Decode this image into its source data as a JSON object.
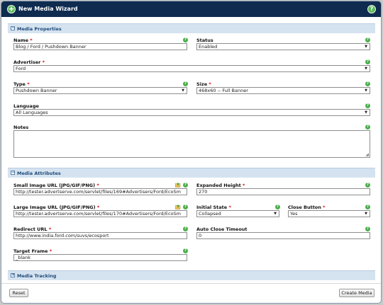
{
  "header": {
    "title": "New Media Wizard",
    "help_glyph": "?",
    "plus_glyph": "+"
  },
  "sections": {
    "properties": "Media Properties",
    "attributes": "Media Attributes",
    "tracking": "Media Tracking",
    "collapse_glyph": "−",
    "expand_glyph": "+"
  },
  "required_mark": "*",
  "help_glyph": "?",
  "select_arrow": "▼",
  "fields": {
    "name": {
      "label": "Name",
      "value": "Blog / Ford / Pushdown Banner"
    },
    "status": {
      "label": "Status",
      "value": "Enabled"
    },
    "advertiser": {
      "label": "Advertiser",
      "value": "Ford"
    },
    "type": {
      "label": "Type",
      "value": "Pushdown Banner"
    },
    "size": {
      "label": "Size",
      "value": "468x60 -- Full Banner"
    },
    "language": {
      "label": "Language",
      "value": "All Languages"
    },
    "notes": {
      "label": "Notes",
      "value": ""
    },
    "small_image": {
      "label": "Small Image URL (JPG/GIF/PNG)",
      "value": "http://tester.advertserve.com/servlet/files/169#Advertisers/Ford/EcoSm"
    },
    "expanded_height": {
      "label": "Expanded Height",
      "value": "270"
    },
    "large_image": {
      "label": "Large Image URL (JPG/GIF/PNG)",
      "value": "http://tester.advertserve.com/servlet/files/170#Advertisers/Ford/EcoSm"
    },
    "initial_state": {
      "label": "Initial State",
      "value": "Collapsed"
    },
    "close_button": {
      "label": "Close Button",
      "value": "Yes"
    },
    "redirect_url": {
      "label": "Redirect URL",
      "value": "http://www.india.ford.com/suvs/ecosport"
    },
    "auto_close": {
      "label": "Auto Close Timeout",
      "value": "0"
    },
    "target_frame": {
      "label": "Target Frame",
      "value": "_blank"
    }
  },
  "buttons": {
    "reset": "Reset",
    "create": "Create Media"
  },
  "colors": {
    "titlebar": "#0f2b50",
    "section": "#d5e3f0",
    "help": "#4cae4c",
    "required": "#dd0000"
  },
  "icons": {
    "upload": "folder-upload-icon",
    "help": "question-icon"
  }
}
